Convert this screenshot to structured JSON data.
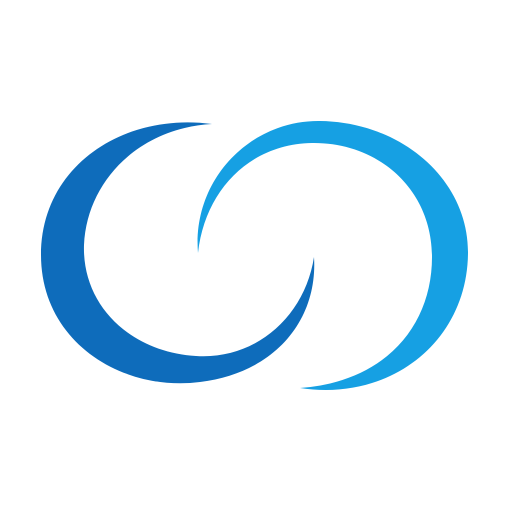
{
  "logo": {
    "name": "infinity-crescent-logo",
    "background_color": "#ffffff",
    "left_crescent_color": "#0e6cbb",
    "right_crescent_color": "#16a0e3"
  }
}
